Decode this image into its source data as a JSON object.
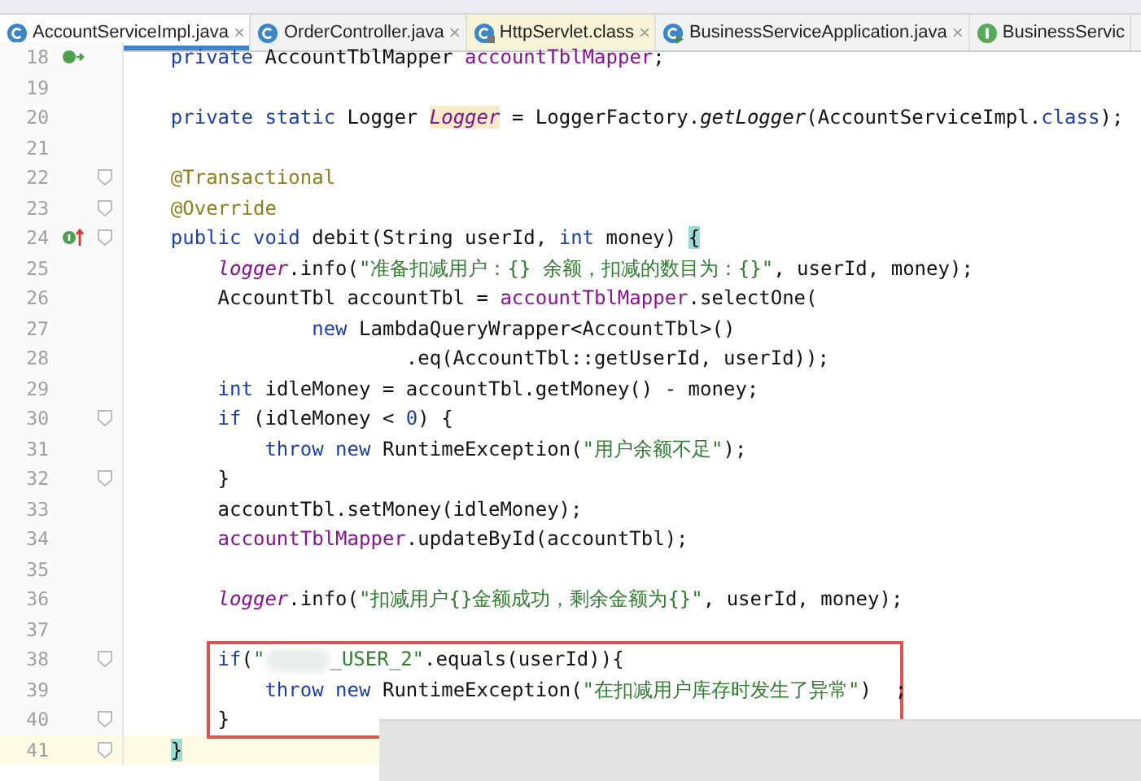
{
  "tabs": [
    {
      "label": "AccountServiceImpl.java",
      "selected": true,
      "kind": "class",
      "library": false,
      "close": "×"
    },
    {
      "label": "OrderController.java",
      "selected": false,
      "kind": "class",
      "library": false,
      "close": "×"
    },
    {
      "label": "HttpServlet.class",
      "selected": false,
      "kind": "locked-class",
      "library": true,
      "close": "×"
    },
    {
      "label": "BusinessServiceApplication.java",
      "selected": false,
      "kind": "run-class",
      "library": false,
      "close": "×"
    },
    {
      "label": "BusinessServic",
      "selected": false,
      "kind": "interface",
      "library": false
    }
  ],
  "lines": [
    {
      "number": "18",
      "kind": "bean",
      "fold": false,
      "current": false,
      "boxed": false,
      "tokens": [
        {
          "kind": "k",
          "text": "    private"
        },
        {
          "kind": "p",
          "text": " AccountTblMapper "
        },
        {
          "kind": "f",
          "text": "accountTblMapper"
        },
        {
          "kind": "p",
          "text": ";"
        }
      ]
    },
    {
      "number": "19",
      "kind": "code",
      "fold": false,
      "current": false,
      "boxed": false
    },
    {
      "number": "20",
      "kind": "code",
      "fold": false,
      "current": false,
      "boxed": false,
      "tokens": [
        {
          "kind": "k",
          "text": "    private static"
        },
        {
          "kind": "p",
          "text": " Logger "
        },
        {
          "kind": "h",
          "text": "Logger"
        },
        {
          "kind": "p",
          "text": " = LoggerFactory."
        },
        {
          "kind": "m",
          "text": "getLogger"
        },
        {
          "kind": "p",
          "text": "(AccountServiceImpl."
        },
        {
          "kind": "k",
          "text": "class"
        },
        {
          "kind": "p",
          "text": ");"
        }
      ]
    },
    {
      "number": "21",
      "kind": "code",
      "fold": false,
      "current": false,
      "boxed": false
    },
    {
      "number": "22",
      "kind": "code",
      "fold": true,
      "current": false,
      "boxed": false,
      "tokens": [
        {
          "kind": "a",
          "text": "    @Transactional"
        }
      ]
    },
    {
      "number": "23",
      "kind": "code",
      "fold": true,
      "current": false,
      "boxed": false,
      "tokens": [
        {
          "kind": "a",
          "text": "    @Override"
        }
      ]
    },
    {
      "number": "24",
      "kind": "override",
      "fold": true,
      "current": false,
      "boxed": false,
      "tokens": [
        {
          "kind": "k",
          "text": "    public void"
        },
        {
          "kind": "p",
          "text": " debit(String userId, "
        },
        {
          "kind": "k",
          "text": "int"
        },
        {
          "kind": "p",
          "text": " money) "
        },
        {
          "kind": "b",
          "text": "{"
        }
      ]
    },
    {
      "number": "25",
      "kind": "code",
      "fold": false,
      "current": false,
      "boxed": false,
      "tokens": [
        {
          "kind": "i",
          "text": "        logger"
        },
        {
          "kind": "p",
          "text": ".info("
        },
        {
          "kind": "s",
          "text": "\"准备扣减用户：{} 余额，扣减的数目为：{}\""
        },
        {
          "kind": "p",
          "text": ", userId, money);"
        }
      ]
    },
    {
      "number": "26",
      "kind": "code",
      "fold": false,
      "current": false,
      "boxed": false,
      "tokens": [
        {
          "kind": "p",
          "text": "        AccountTbl accountTbl = "
        },
        {
          "kind": "f",
          "text": "accountTblMapper"
        },
        {
          "kind": "p",
          "text": ".selectOne("
        }
      ]
    },
    {
      "number": "27",
      "kind": "code",
      "fold": false,
      "current": false,
      "boxed": false,
      "tokens": [
        {
          "kind": "k",
          "text": "                new"
        },
        {
          "kind": "p",
          "text": " LambdaQueryWrapper<AccountTbl>()"
        }
      ]
    },
    {
      "number": "28",
      "kind": "code",
      "fold": false,
      "current": false,
      "boxed": false,
      "tokens": [
        {
          "kind": "p",
          "text": "                        .eq(AccountTbl::getUserId, userId));"
        }
      ]
    },
    {
      "number": "29",
      "kind": "code",
      "fold": false,
      "current": false,
      "boxed": false,
      "tokens": [
        {
          "kind": "k",
          "text": "        int"
        },
        {
          "kind": "p",
          "text": " idleMoney = accountTbl.getMoney() - money;"
        }
      ]
    },
    {
      "number": "30",
      "kind": "code",
      "fold": true,
      "current": false,
      "boxed": false,
      "tokens": [
        {
          "kind": "k",
          "text": "        if"
        },
        {
          "kind": "p",
          "text": " (idleMoney < "
        },
        {
          "kind": "n",
          "text": "0"
        },
        {
          "kind": "p",
          "text": ") {"
        }
      ]
    },
    {
      "number": "31",
      "kind": "code",
      "fold": false,
      "current": false,
      "boxed": false,
      "tokens": [
        {
          "kind": "k",
          "text": "            throw new"
        },
        {
          "kind": "p",
          "text": " RuntimeException("
        },
        {
          "kind": "s",
          "text": "\"用户余额不足\""
        },
        {
          "kind": "p",
          "text": ");"
        }
      ]
    },
    {
      "number": "32",
      "kind": "code",
      "fold": true,
      "current": false,
      "boxed": false,
      "tokens": [
        {
          "kind": "p",
          "text": "        }"
        }
      ]
    },
    {
      "number": "33",
      "kind": "code",
      "fold": false,
      "current": false,
      "boxed": false,
      "tokens": [
        {
          "kind": "p",
          "text": "        accountTbl.setMoney(idleMoney);"
        }
      ]
    },
    {
      "number": "34",
      "kind": "code",
      "fold": false,
      "current": false,
      "boxed": false,
      "tokens": [
        {
          "kind": "f",
          "text": "        accountTblMapper"
        },
        {
          "kind": "p",
          "text": ".updateById(accountTbl);"
        }
      ]
    },
    {
      "number": "35",
      "kind": "code",
      "fold": false,
      "current": false,
      "boxed": false
    },
    {
      "number": "36",
      "kind": "code",
      "fold": false,
      "current": false,
      "boxed": false,
      "tokens": [
        {
          "kind": "i",
          "text": "        logger"
        },
        {
          "kind": "p",
          "text": ".info("
        },
        {
          "kind": "s",
          "text": "\"扣减用户{}金额成功，剩余金额为{}\""
        },
        {
          "kind": "p",
          "text": ", userId, money);"
        }
      ]
    },
    {
      "number": "37",
      "kind": "code",
      "fold": false,
      "current": false,
      "boxed": false
    },
    {
      "number": "38",
      "kind": "code",
      "fold": true,
      "current": false,
      "boxed": true,
      "tokens": [
        {
          "kind": "k",
          "text": "        if"
        },
        {
          "kind": "p",
          "text": "("
        },
        {
          "kind": "s",
          "text": "\""
        },
        {
          "kind": "redacted"
        },
        {
          "kind": "s",
          "text": "_USER_2\""
        },
        {
          "kind": "p",
          "text": ".equals(userId)){"
        }
      ]
    },
    {
      "number": "39",
      "kind": "code",
      "fold": false,
      "current": false,
      "boxed": true,
      "tokens": [
        {
          "kind": "k",
          "text": "            throw new"
        },
        {
          "kind": "p",
          "text": " RuntimeException("
        },
        {
          "kind": "s",
          "text": "\"在扣减用户库存时发生了异常\""
        },
        {
          "kind": "p",
          "text": ")  ;"
        }
      ]
    },
    {
      "number": "40",
      "kind": "code",
      "fold": true,
      "current": false,
      "boxed": true,
      "tokens": [
        {
          "kind": "p",
          "text": "        }"
        }
      ]
    },
    {
      "number": "41",
      "kind": "code",
      "fold": true,
      "current": true,
      "boxed": false,
      "tokens": [
        {
          "kind": "b",
          "text": "    }"
        }
      ]
    }
  ]
}
